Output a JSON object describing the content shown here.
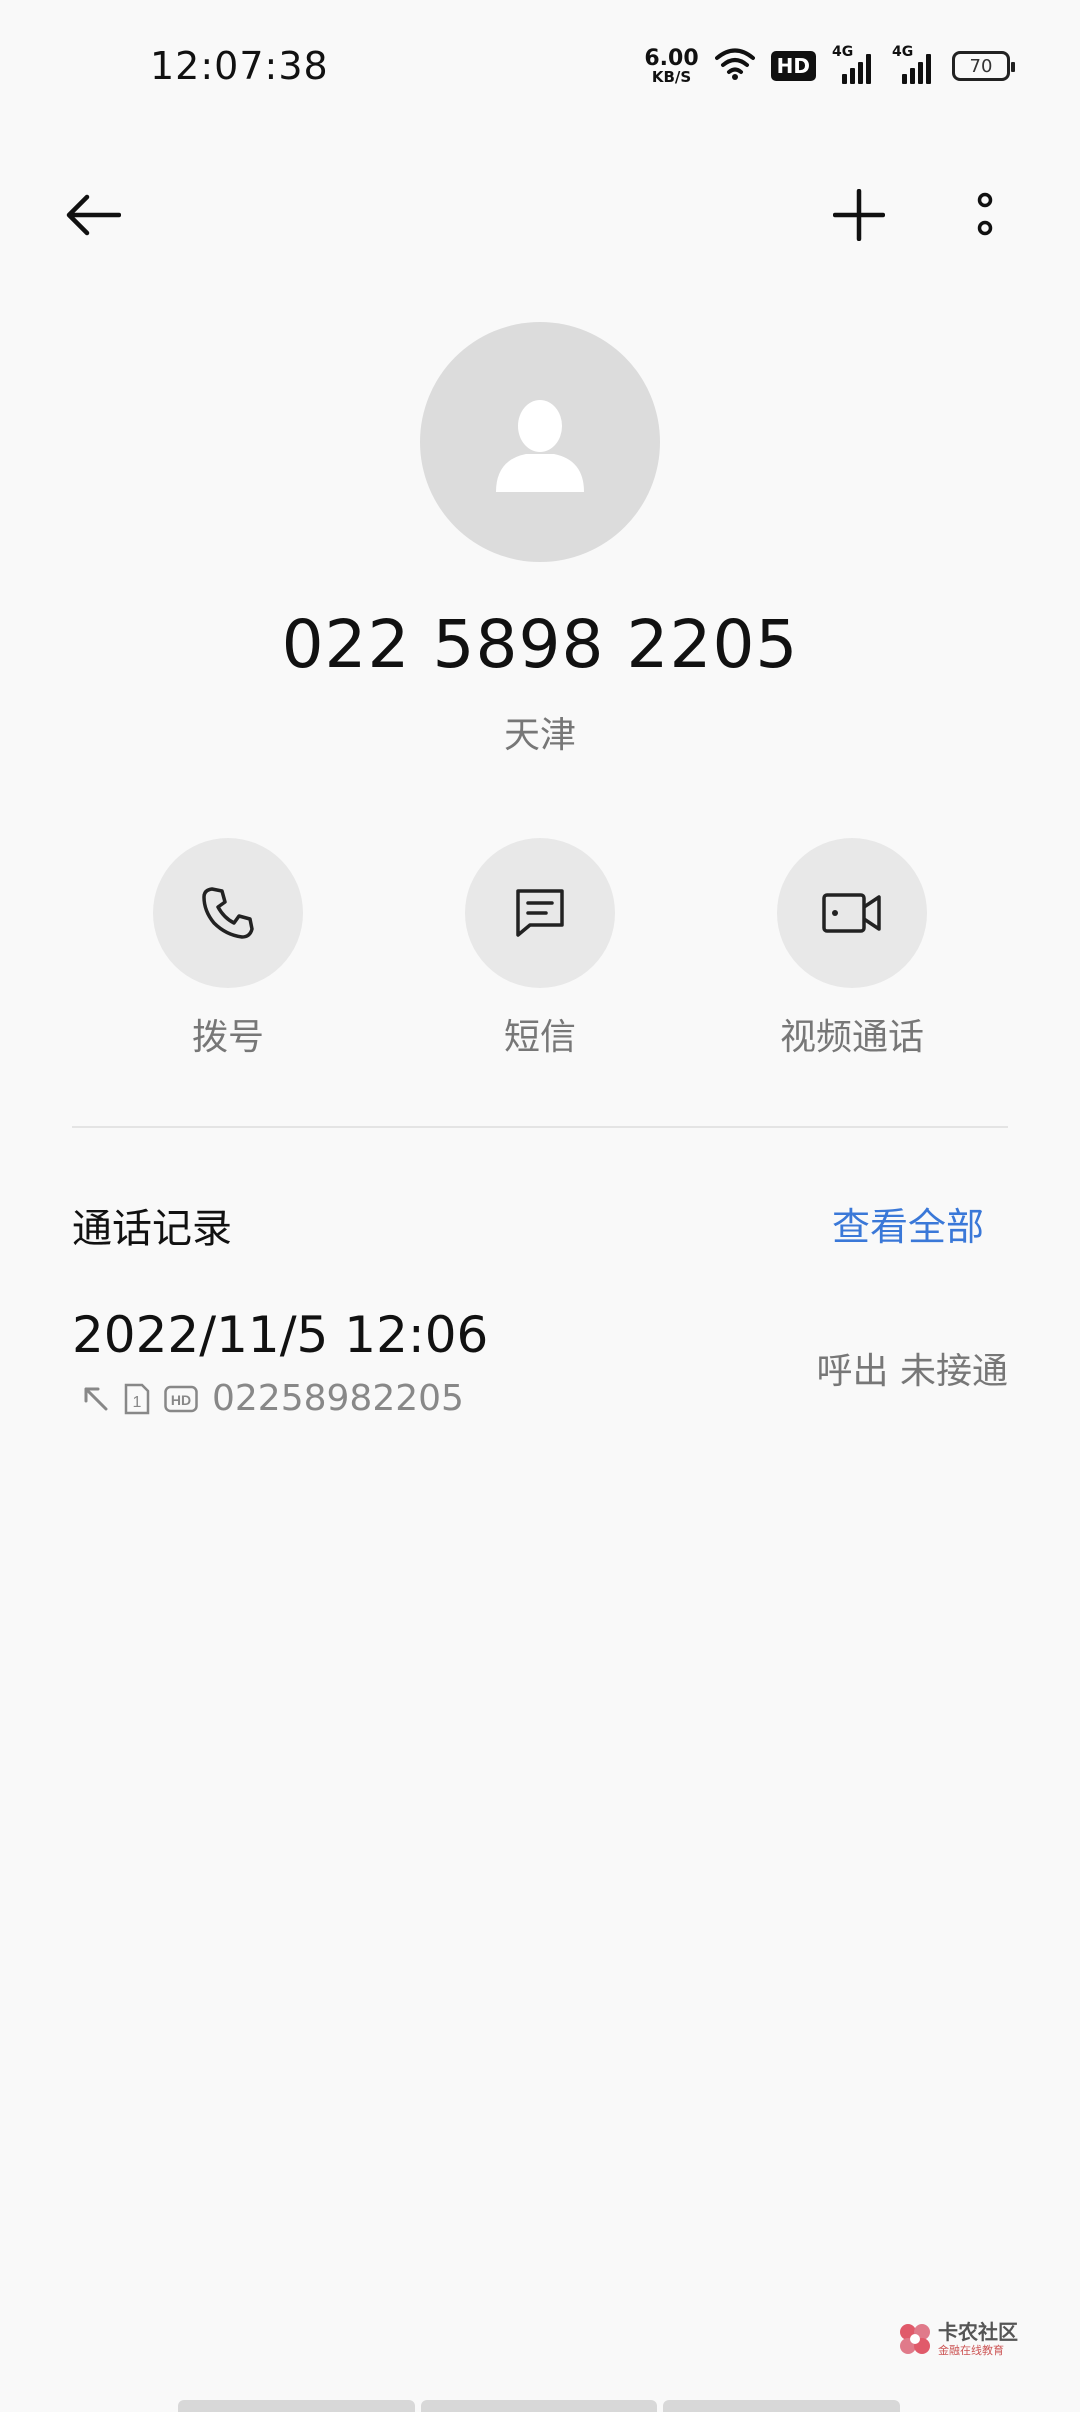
{
  "status_bar": {
    "time": "12:07:38",
    "net_speed_value": "6.00",
    "net_speed_unit": "KB/S",
    "hd_label": "HD",
    "sim1_label": "4G",
    "sim2_label": "4G",
    "battery": "70"
  },
  "contact": {
    "number": "022 5898 2205",
    "location": "天津"
  },
  "actions": {
    "call": "拨号",
    "sms": "短信",
    "video": "视频通话"
  },
  "call_log": {
    "title": "通话记录",
    "view_all": "查看全部",
    "records": [
      {
        "time": "2022/11/5 12:06",
        "sim": "1",
        "hd": "HD",
        "number": "02258982205",
        "status": "呼出 未接通"
      }
    ]
  },
  "watermark": {
    "main": "卡农社区",
    "sub": "金融在线教育"
  },
  "colors": {
    "background": "#f9f9f9",
    "accent": "#3a78d8",
    "avatar_bg": "#dcdcdc",
    "action_bg": "#e8e8e8"
  }
}
